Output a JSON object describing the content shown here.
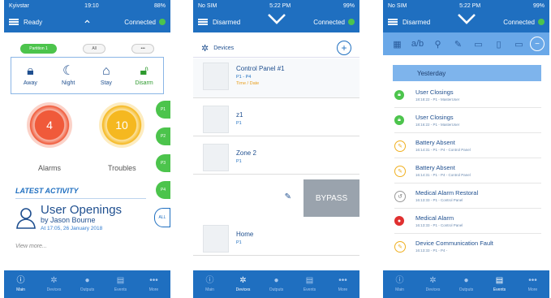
{
  "phone1": {
    "status": {
      "carrier": "Kyivstar",
      "time": "19:10",
      "battery": "88%"
    },
    "header": {
      "title": "Ready",
      "connection": "Connected"
    },
    "chips": [
      "Partition 1",
      "All",
      "•••"
    ],
    "modes": [
      {
        "label": "Away",
        "icon": "lock-icon"
      },
      {
        "label": "Night",
        "icon": "moon-icon"
      },
      {
        "label": "Stay",
        "icon": "home-icon"
      },
      {
        "label": "Disarm",
        "icon": "unlock-icon"
      }
    ],
    "alarms": {
      "count": "4",
      "label": "Alarms"
    },
    "troubles": {
      "count": "10",
      "label": "Troubles"
    },
    "partitions": [
      "P1",
      "P2",
      "P3",
      "P4"
    ],
    "all_label": "ALL",
    "latest_activity": "LATEST ACTIVITY",
    "activity": {
      "title": "User Openings",
      "by": "by Jason Bourne",
      "at": "At 17:05, 26 January 2018"
    },
    "view_more": "View more..."
  },
  "phone2": {
    "status": {
      "carrier": "No SIM",
      "time": "5:22 PM",
      "battery": "99%"
    },
    "header": {
      "title": "Disarmed",
      "connection": "Connected"
    },
    "devices_label": "Devices",
    "devices": [
      {
        "name": "Control Panel #1",
        "sub": "P1 - P4",
        "time": "Time / Date"
      },
      {
        "name": "z1",
        "sub": "P1"
      },
      {
        "name": "Zone 2",
        "sub": "P1"
      },
      {
        "name": "Home",
        "sub": "P1"
      }
    ],
    "bypass_label": "BYPASS"
  },
  "phone3": {
    "status": {
      "carrier": "No SIM",
      "time": "5:22 PM",
      "battery": "99%"
    },
    "header": {
      "title": "Disarmed",
      "connection": "Connected"
    },
    "day": "Yesterday",
    "events": [
      {
        "title": "User Closings",
        "sub": "18:18:22 - P1 - MasterUser",
        "icon": "lock-icon",
        "color": "#4cc44c"
      },
      {
        "title": "User Closings",
        "sub": "18:16:22 - P1 - MasterUser",
        "icon": "lock-icon",
        "color": "#4cc44c"
      },
      {
        "title": "Battery Absent",
        "sub": "16:14:31 - P1 - P4 - Control Panel",
        "icon": "warning-icon",
        "color": "#f0b020"
      },
      {
        "title": "Battery Absent",
        "sub": "16:14:31 - P1 - P4 - Control Panel",
        "icon": "warning-icon",
        "color": "#f0b020"
      },
      {
        "title": "Medical Alarm Restoral",
        "sub": "16:13:33 - P1 - Control Panel",
        "icon": "restore-icon",
        "color": "#888888"
      },
      {
        "title": "Medical Alarm",
        "sub": "16:13:33 - P1 - Control Panel",
        "icon": "alarm-icon",
        "color": "#e03030"
      },
      {
        "title": "Device Communication Fault",
        "sub": "16:13:33 - P1 - P4 -",
        "icon": "warning-icon",
        "color": "#f0b020"
      }
    ]
  },
  "tabs": {
    "phone1": [
      "Main",
      "Devices",
      "Outputs",
      "Events",
      "More"
    ],
    "phone2": [
      "Main",
      "Devices",
      "Outputs",
      "Events",
      "More"
    ],
    "phone3": [
      "Main",
      "Devices",
      "Outputs",
      "Events",
      "More"
    ]
  }
}
